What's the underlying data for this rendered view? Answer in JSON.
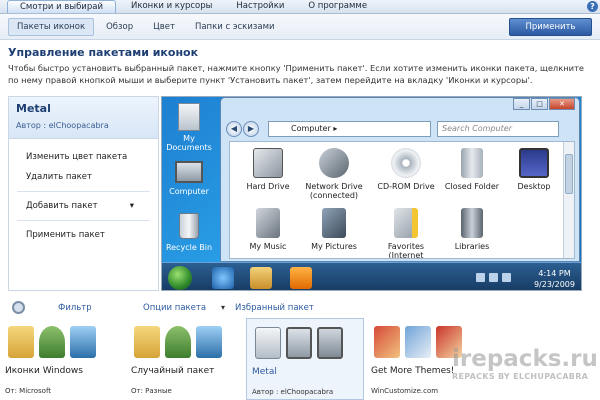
{
  "top_tabs": [
    "Смотри и выбирай",
    "Иконки и курсоры",
    "Настройки",
    "О программе"
  ],
  "help_glyph": "?",
  "sub_tabs": [
    "Пакеты иконок",
    "Обзор",
    "Цвет",
    "Папки с эскизами"
  ],
  "apply_button": "Применить",
  "page_title": "Управление пакетами иконок",
  "description": "Чтобы быстро установить выбранный пакет, нажмите кнопку 'Применить пакет'. Если хотите изменить иконки пакета, щелкните по нему правой кнопкой мыши и выберите пункт 'Установить пакет', затем перейдите на вкладку 'Иконки и курсоры'.",
  "pack": {
    "name": "Metal",
    "author": "Автор : elChoopacabra",
    "actions": [
      "Изменить цвет пакета",
      "Удалить пакет"
    ],
    "add_pack": "Добавить пакет",
    "add_pack_caret": "▾",
    "apply_pack": "Применить пакет"
  },
  "preview": {
    "desktop_icons": [
      {
        "label": "My Documents",
        "icon": "documents-icon"
      },
      {
        "label": "Computer",
        "icon": "monitor-icon"
      },
      {
        "label": "Recycle Bin",
        "icon": "recycle-bin-icon"
      }
    ],
    "window_buttons": [
      "_",
      "□",
      "✕"
    ],
    "nav_glyphs": [
      "◀",
      "▶"
    ],
    "address": "Computer ▸",
    "search_placeholder": "Search Computer",
    "items": [
      {
        "label": "Hard Drive",
        "icon": "hard-drive-icon"
      },
      {
        "label": "Network Drive (connected)",
        "icon": "network-drive-icon"
      },
      {
        "label": "CD-ROM Drive",
        "icon": "cdrom-icon"
      },
      {
        "label": "Closed Folder",
        "icon": "folder-icon"
      },
      {
        "label": "Desktop",
        "icon": "desktop-icon"
      },
      {
        "label": "My Music",
        "icon": "music-icon"
      },
      {
        "label": "My Pictures",
        "icon": "pictures-icon"
      },
      {
        "label": "Favorites (Internet Explorer)",
        "icon": "favorites-icon"
      },
      {
        "label": "Libraries",
        "icon": "libraries-icon"
      }
    ],
    "clock_time": "4:14 PM",
    "clock_date": "9/23/2009"
  },
  "bottom": {
    "filter": "Фильтр",
    "pack_options": "Опции пакета",
    "caret": "▾",
    "favorite": "Избранный пакет",
    "thumbnails": [
      {
        "label": "Иконки Windows",
        "author": "От: Microsoft"
      },
      {
        "label": "Случайный пакет",
        "author": "От: Разные"
      },
      {
        "label": "Metal",
        "author": "Автор : elChoopacabra"
      },
      {
        "label": "Get More Themes!",
        "author": "WinCustomize.com"
      }
    ]
  },
  "watermark": {
    "site": "irepacks.ru",
    "tag": "REPACKS BY ELCHUPACABRA"
  },
  "colors": {
    "accent": "#2b5aa4",
    "title": "#1e3f73",
    "desktop": "#1d7fd0"
  }
}
